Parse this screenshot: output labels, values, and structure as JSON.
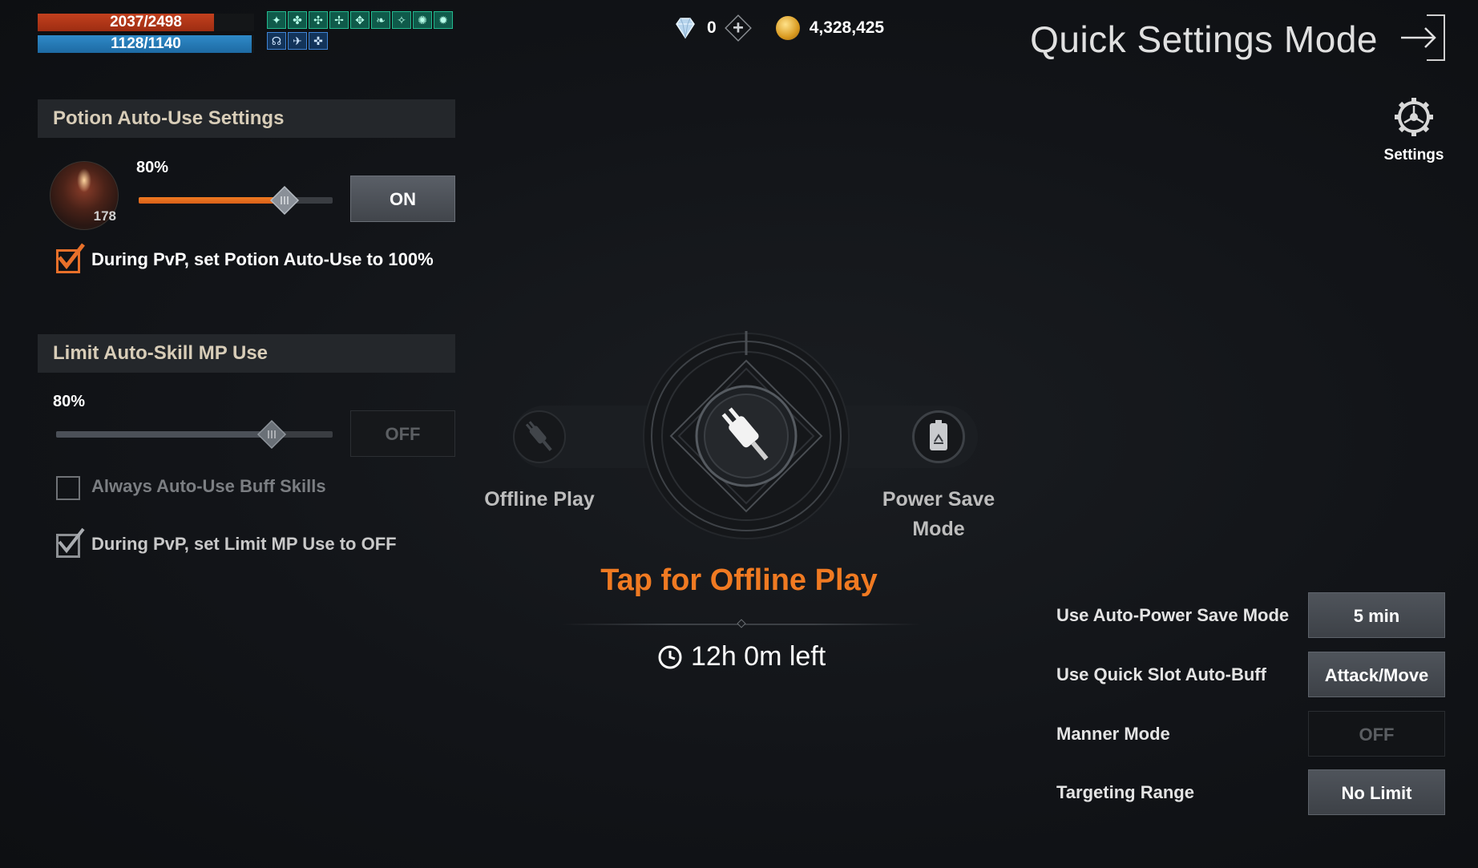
{
  "status": {
    "hp_text": "2037/2498",
    "hp_ratio": 0.815,
    "mp_text": "1128/1140",
    "mp_ratio": 0.99,
    "buffs_row1": [
      "✦",
      "✤",
      "✣",
      "✢",
      "✥",
      "❧",
      "✧",
      "✺",
      "✹"
    ],
    "buffs_row2": [
      "☊",
      "✈",
      "✜"
    ]
  },
  "currency": {
    "gems": "0",
    "gold": "4,328,425"
  },
  "header": {
    "title": "Quick Settings Mode",
    "settings_label": "Settings"
  },
  "potion": {
    "section_title": "Potion Auto-Use Settings",
    "percent_label": "80%",
    "percent_value": 0.75,
    "count": "178",
    "toggle": "ON",
    "pvp_check_label": "During PvP, set Potion Auto-Use to 100%",
    "pvp_checked": true
  },
  "mp_limit": {
    "section_title": "Limit Auto-Skill MP Use",
    "percent_label": "80%",
    "percent_value": 0.78,
    "toggle": "OFF",
    "buff_check_label": "Always Auto-Use Buff Skills",
    "buff_checked": false,
    "pvp_check_label": "During PvP, set Limit MP Use to OFF",
    "pvp_checked": true
  },
  "offline": {
    "offline_label": "Offline Play",
    "power_save_label_line1": "Power Save",
    "power_save_label_line2": "Mode",
    "tap_text": "Tap for Offline Play",
    "time_left": "12h 0m left"
  },
  "options": [
    {
      "label": "Use Auto-Power Save Mode",
      "value": "5 min",
      "state": "active"
    },
    {
      "label": "Use Quick Slot Auto-Buff",
      "value": "Attack/Move",
      "state": "active"
    },
    {
      "label": "Manner Mode",
      "value": "OFF",
      "state": "off"
    },
    {
      "label": "Targeting Range",
      "value": "No Limit",
      "state": "active"
    }
  ],
  "colors": {
    "accent": "#f07a22",
    "hp": "#b8391a",
    "mp": "#2a82c0",
    "check": "#e8702a"
  }
}
